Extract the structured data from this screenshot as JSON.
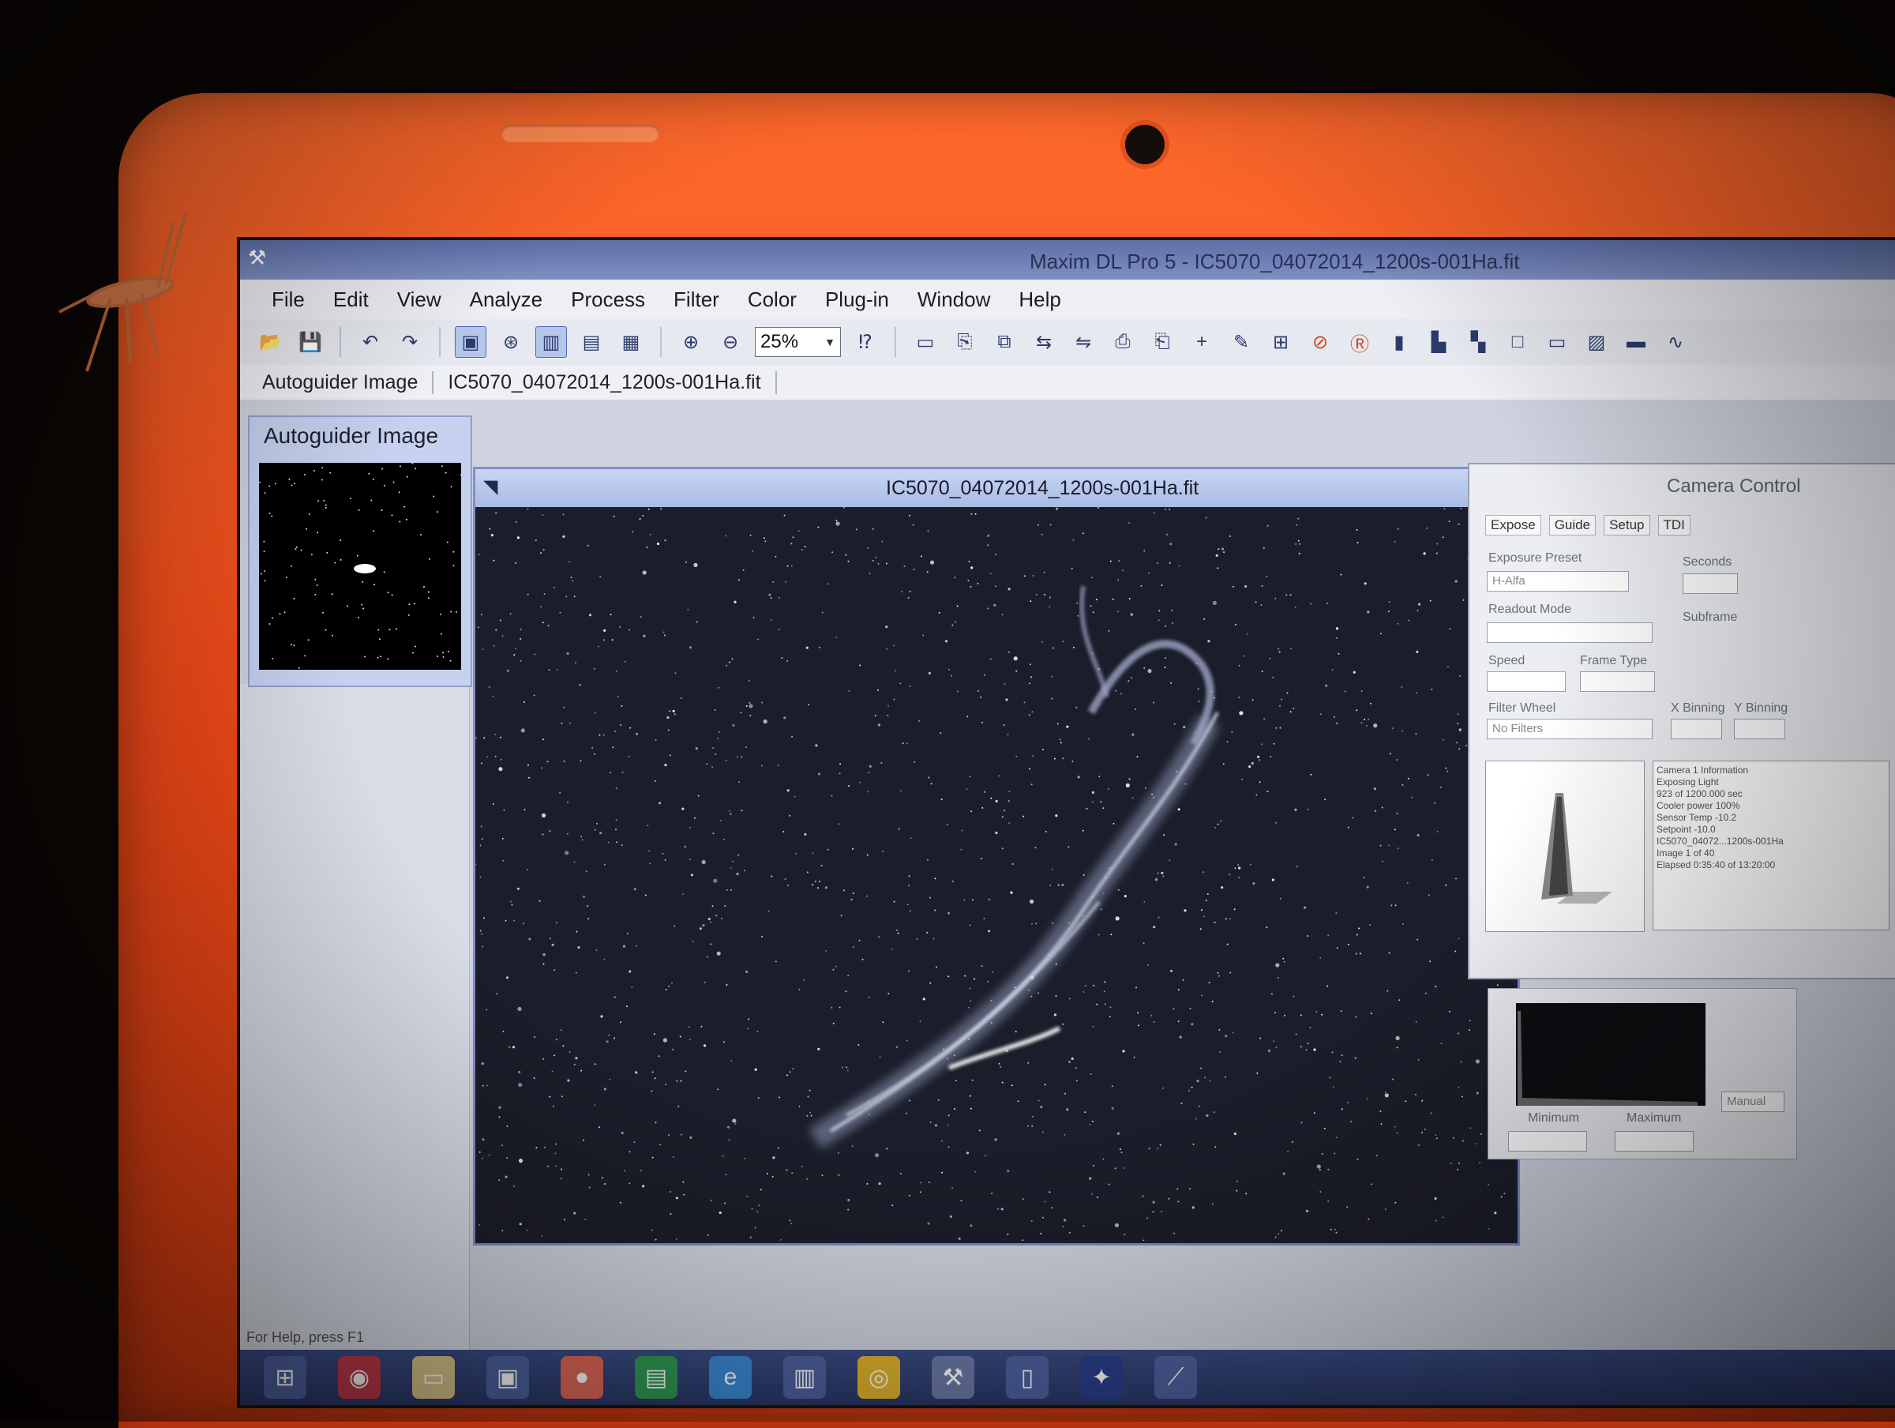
{
  "window": {
    "title": "Maxim DL Pro 5 - IC5070_04072014_1200s-001Ha.fit"
  },
  "menu": [
    "File",
    "Edit",
    "View",
    "Analyze",
    "Process",
    "Filter",
    "Color",
    "Plug-in",
    "Window",
    "Help"
  ],
  "toolbar": {
    "zoom_value": "25%"
  },
  "tabs": [
    "Autoguider Image",
    "IC5070_04072014_1200s-001Ha.fit"
  ],
  "autoguider": {
    "title": "Autoguider Image"
  },
  "image_window": {
    "title": "IC5070_04072014_1200s-001Ha.fit"
  },
  "camera_control": {
    "title": "Camera Control",
    "tabs": [
      "Expose",
      "Guide",
      "Setup",
      "TDI"
    ],
    "exposure_preset_label": "Exposure Preset",
    "exposure_preset_value": "H-Alfa",
    "seconds_label": "Seconds",
    "readout_mode_label": "Readout Mode",
    "speed_label": "Speed",
    "frame_type_label": "Frame Type",
    "filter_wheel_label": "Filter Wheel",
    "filter_wheel_value": "No Filters",
    "x_binning_label": "X Binning",
    "y_binning_label": "Y Binning",
    "subframe_label": "Subframe",
    "info_lines": [
      "Camera 1 Information",
      "Exposing Light",
      "923 of 1200.000 sec",
      "Cooler power 100%",
      "Sensor Temp -10.2",
      "Setpoint -10.0",
      "IC5070_04072...1200s-001Ha",
      "Image 1 of 40",
      "Elapsed 0:35:40 of 13:20:00"
    ]
  },
  "histogram": {
    "minimum_label": "Minimum",
    "maximum_label": "Maximum",
    "mode_value": "Manual"
  },
  "status": {
    "help_text": "For Help, press F1"
  },
  "colors": {
    "laptop_orange": "#f24a18",
    "titlebar_blue": "#5d6fa8",
    "sky": "#1d1f2c"
  }
}
